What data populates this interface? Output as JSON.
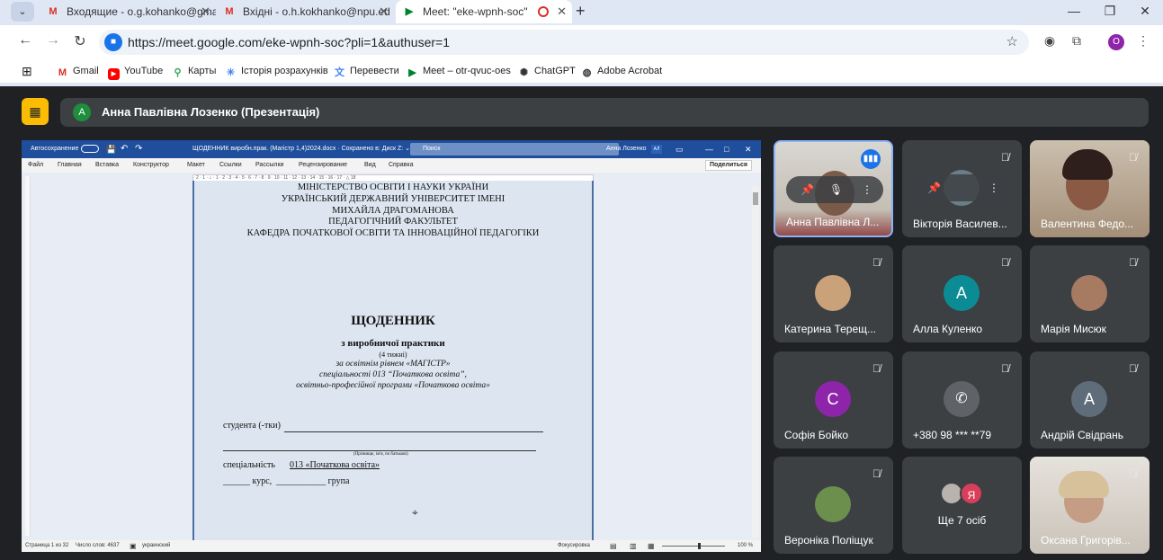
{
  "browser": {
    "tabs": [
      {
        "title": "Входящие - o.g.kohanko@gma",
        "icon": "gmail-icon"
      },
      {
        "title": "Вхідні - o.h.kokhanko@npu.ed",
        "icon": "gmail-icon"
      },
      {
        "title": "Meet: \"eke-wpnh-soc\"",
        "icon": "meet-icon"
      }
    ],
    "url": "https://meet.google.com/eke-wpnh-soc?pli=1&authuser=1",
    "profile_initial": "O",
    "bookmarks": [
      "Gmail",
      "YouTube",
      "Карты",
      "Історія розрахунків",
      "Перевести",
      "Meet – otr-qvuc-oes",
      "ChatGPT",
      "Adobe Acrobat"
    ]
  },
  "meet": {
    "presenter_initial": "А",
    "presentation_title": "Анна Павлівна Лозенко (Презентація)",
    "word": {
      "autosave": "Автосохранение",
      "doc_title": "ЩОДЕННИК виробн.прак. (Магістр 1,4)2024.docx · Сохранено в: Диск Z: ⌄",
      "search": "Поиск",
      "user": "Анна Лозенко",
      "user_initials": "АЛ",
      "menu": [
        "Файл",
        "Главная",
        "Вставка",
        "Конструктор",
        "Макет",
        "Ссылки",
        "Рассылки",
        "Рецензирование",
        "Вид",
        "Справка"
      ],
      "share": "Поделиться",
      "ruler": "· 2 · 1 · ⌂ · 1 · 2 · 3 · 4 · 5 · 6 · 7 · 8 · 9 · 10 · 11 · 12 · 13 · 14 · 15 · 16 · 17 · △ 18",
      "status": {
        "page": "Страница 1 из 32",
        "words": "Число слов: 4637",
        "lang": "украинский",
        "focus": "Фокусировка",
        "zoom": "100 %"
      }
    },
    "document": {
      "line1": "МІНІСТЕРСТВО ОСВІТИ І НАУКИ УКРАЇНИ",
      "line2": "УКРАЇНСЬКИЙ ДЕРЖАВНИЙ УНІВЕРСИТЕТ ІМЕНІ",
      "line3": "МИХАЙЛА ДРАГОМАНОВА",
      "line4": "ПЕДАГОГІЧНИЙ ФАКУЛЬТЕТ",
      "line5": "КАФЕДРА ПОЧАТКОВОЇ ОСВІТИ ТА ІННОВАЦІЙНОЇ ПЕДАГОГІКИ",
      "title": "ЩОДЕННИК",
      "subtitle": "з виробничої практики",
      "weeks": "(4 тижні)",
      "level": "за освітнім рівнем «МАГІСТР»",
      "specialty": "спеціальності 013 “Початкова освіта”,",
      "program": "освітньо-професійної програми «Початкова освіта»",
      "student": "студента (-тки)",
      "name_hint": "(Прізвище, ім'я, по батькові)",
      "spec_label": "спеціальність",
      "spec_value": "013 «Початкова освіта»",
      "course": "______ курс,  ___________ група"
    },
    "participants": [
      {
        "name": "Анна Павлівна Л...",
        "type": "video",
        "speaking": true
      },
      {
        "name": "Вікторія Василев...",
        "type": "photo"
      },
      {
        "name": "Валентина Федо...",
        "type": "video"
      },
      {
        "name": "Катерина Терещ...",
        "type": "photo"
      },
      {
        "name": "Алла Куленко",
        "initial": "А",
        "color": "#0b8c94"
      },
      {
        "name": "Марія Мисюк",
        "type": "photo"
      },
      {
        "name": "Софія Бойко",
        "initial": "С",
        "color": "#8e24aa"
      },
      {
        "name": "+380 98 *** **79",
        "type": "phone"
      },
      {
        "name": "Андрій Свідрань",
        "initial": "А",
        "color": "#5f6d7a"
      },
      {
        "name": "Вероніка Поліщук",
        "type": "photo"
      },
      {
        "name": "Ще 7 осіб",
        "initial": "Я",
        "color": "#d93f5b"
      },
      {
        "name": "Оксана Григорів...",
        "type": "video"
      }
    ]
  }
}
